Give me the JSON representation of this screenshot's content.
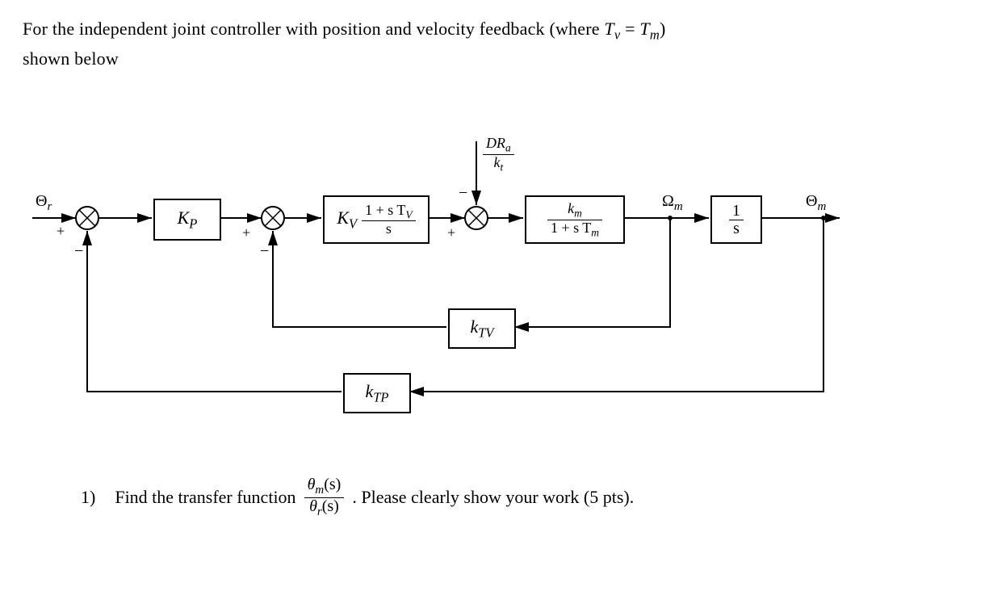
{
  "intro": {
    "line1_a": "For the independent joint controller with position and velocity feedback (where ",
    "Tv": "T",
    "Tv_sub": "v",
    "eq": " = ",
    "Tm": "T",
    "Tm_sub": "m",
    "line1_b": ")",
    "line2": "shown below"
  },
  "signals": {
    "theta_r": "Θ",
    "theta_r_sub": "r",
    "omega_m": "Ω",
    "omega_m_sub": "m",
    "theta_m": "Θ",
    "theta_m_sub": "m",
    "disturbance_num": "DR",
    "disturbance_num_sub": "a",
    "disturbance_den": "k",
    "disturbance_den_sub": "t"
  },
  "sum_signs": {
    "s1_plus": "+",
    "s1_minus": "−",
    "s2_plus": "+",
    "s2_minus": "−",
    "s3_plus": "+",
    "s3_minus": "−"
  },
  "blocks": {
    "Kp": {
      "K": "K",
      "sub": "P"
    },
    "Kv": {
      "K": "K",
      "sub": "V",
      "num_a": "1 + s T",
      "num_sub": "V",
      "den": "s"
    },
    "plant": {
      "num": "k",
      "num_sub": "m",
      "den_a": "1 + s T",
      "den_sub": "m"
    },
    "integrator": {
      "num": "1",
      "den": "s"
    },
    "ktv": {
      "k": "k",
      "sub": "TV"
    },
    "ktp": {
      "k": "k",
      "sub": "TP"
    }
  },
  "question": {
    "num": "1)",
    "a": "Find the transfer function ",
    "frac_num": "θ",
    "frac_num_sub": "m",
    "frac_num_arg": "(s)",
    "frac_den": "θ",
    "frac_den_sub": "r",
    "frac_den_arg": "(s)",
    "b": ". Please clearly show your work (5 pts)."
  }
}
